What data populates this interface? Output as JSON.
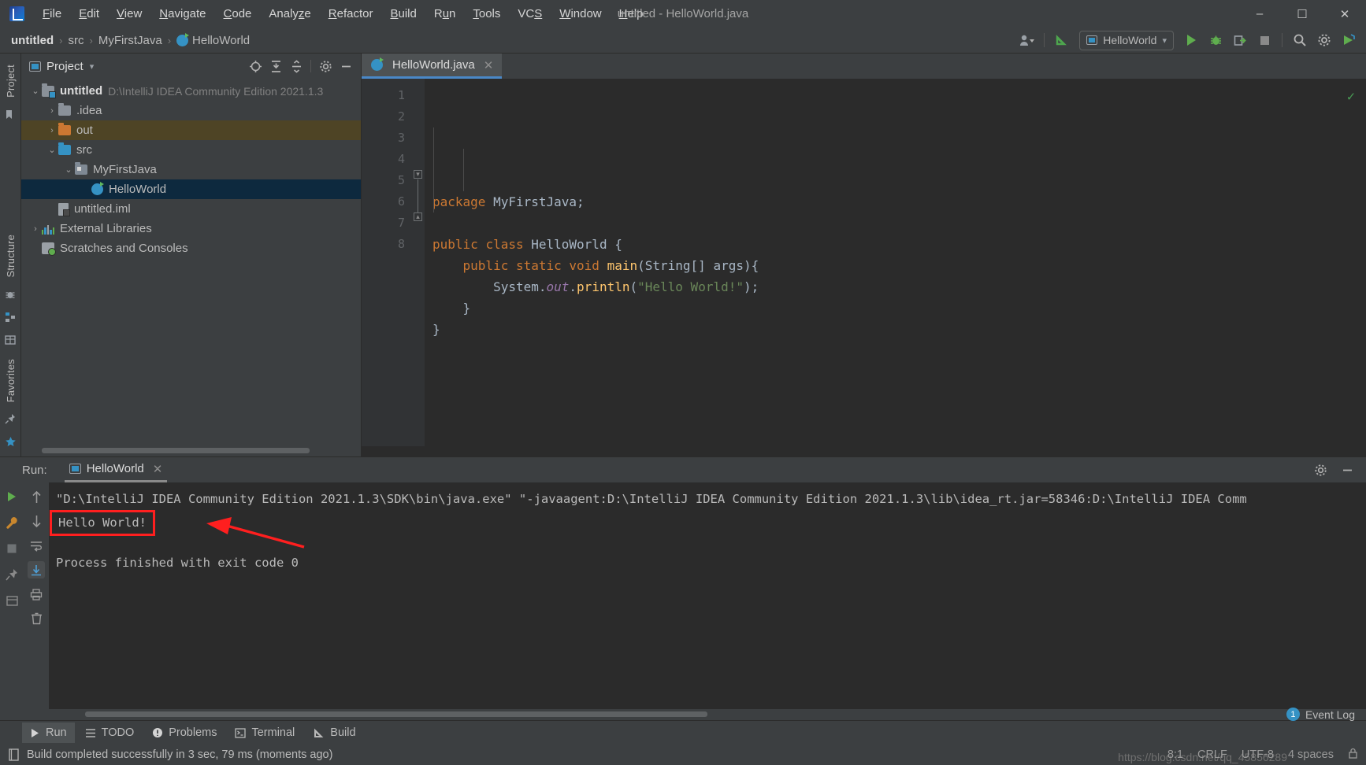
{
  "window": {
    "title": "untitled - HelloWorld.java",
    "minimize": "–",
    "maximize": "☐",
    "close": "✕"
  },
  "menubar": {
    "logo_name": "intellij-idea-logo",
    "items": [
      {
        "label": "File",
        "mnemonic": "F"
      },
      {
        "label": "Edit",
        "mnemonic": "E"
      },
      {
        "label": "View",
        "mnemonic": "V"
      },
      {
        "label": "Navigate",
        "mnemonic": "N"
      },
      {
        "label": "Code",
        "mnemonic": "C"
      },
      {
        "label": "Analyze",
        "mnemonic": "z"
      },
      {
        "label": "Refactor",
        "mnemonic": "R"
      },
      {
        "label": "Build",
        "mnemonic": "B"
      },
      {
        "label": "Run",
        "mnemonic": "u"
      },
      {
        "label": "Tools",
        "mnemonic": "T"
      },
      {
        "label": "VCS",
        "mnemonic": "S"
      },
      {
        "label": "Window",
        "mnemonic": "W"
      },
      {
        "label": "Help",
        "mnemonic": "H"
      }
    ]
  },
  "navbar": {
    "crumbs": [
      "untitled",
      "src",
      "MyFirstJava",
      "HelloWorld"
    ],
    "separator": "›",
    "run_config": "HelloWorld",
    "icons": {
      "account": "account-icon",
      "update": "update-project-icon",
      "run": "run-icon",
      "debug": "debug-icon",
      "run_coverage": "run-with-coverage-icon",
      "stop": "stop-icon",
      "search": "search-everywhere-icon",
      "settings": "settings-icon",
      "plugin": "plugin-icon"
    }
  },
  "left_strip": {
    "project_tab": "Project",
    "structure_tab": "Structure",
    "favorites_tab": "Favorites"
  },
  "project_panel": {
    "title": "Project",
    "toolbar_icons": [
      "locate-icon",
      "expand-all-icon",
      "collapse-all-icon",
      "gear-icon",
      "hide-icon"
    ],
    "tree": [
      {
        "label": "untitled",
        "path": "D:\\IntelliJ IDEA Community Edition 2021.1.3",
        "indent": 0,
        "arrow": "⌄",
        "icon": "module",
        "bold": true,
        "state": "normal"
      },
      {
        "label": ".idea",
        "path": "",
        "indent": 1,
        "arrow": "›",
        "icon": "folder-gray",
        "bold": false,
        "state": "normal"
      },
      {
        "label": "out",
        "path": "",
        "indent": 1,
        "arrow": "›",
        "icon": "folder-orange",
        "bold": false,
        "state": "amber"
      },
      {
        "label": "src",
        "path": "",
        "indent": 1,
        "arrow": "⌄",
        "icon": "folder-blue",
        "bold": false,
        "state": "normal"
      },
      {
        "label": "MyFirstJava",
        "path": "",
        "indent": 2,
        "arrow": "⌄",
        "icon": "folder-package",
        "bold": false,
        "state": "normal"
      },
      {
        "label": "HelloWorld",
        "path": "",
        "indent": 3,
        "arrow": "",
        "icon": "java-class",
        "bold": false,
        "state": "selected"
      },
      {
        "label": "untitled.iml",
        "path": "",
        "indent": 1,
        "arrow": "",
        "icon": "iml-file",
        "bold": false,
        "state": "normal"
      },
      {
        "label": "External Libraries",
        "path": "",
        "indent": 0,
        "arrow": "›",
        "icon": "libraries",
        "bold": false,
        "state": "normal"
      },
      {
        "label": "Scratches and Consoles",
        "path": "",
        "indent": 0,
        "arrow": "",
        "icon": "scratches",
        "bold": false,
        "state": "normal"
      }
    ]
  },
  "editor": {
    "tab_label": "HelloWorld.java",
    "tab_close": "✕",
    "inspection_ok": "✓",
    "line_numbers": [
      "1",
      "2",
      "3",
      "4",
      "5",
      "6",
      "7",
      "8"
    ],
    "code_lines": [
      {
        "n": 1,
        "text": "package MyFirstJava;"
      },
      {
        "n": 2,
        "text": ""
      },
      {
        "n": 3,
        "text": "public class HelloWorld {"
      },
      {
        "n": 4,
        "text": "    public static void main(String[] args){"
      },
      {
        "n": 5,
        "text": "        System.out.println(\"Hello World!\");"
      },
      {
        "n": 6,
        "text": "    }"
      },
      {
        "n": 7,
        "text": "}"
      },
      {
        "n": 8,
        "text": ""
      }
    ],
    "gutter_run_lines": [
      3,
      4
    ],
    "colors": {
      "keyword": "#cc7832",
      "string": "#6a8759",
      "field": "#9876aa",
      "method": "#ffc66d",
      "default": "#a9b7c6",
      "background": "#2b2b2b"
    }
  },
  "run_panel": {
    "label": "Run:",
    "tab": "HelloWorld",
    "tab_close": "✕",
    "console_lines": [
      "\"D:\\IntelliJ IDEA Community Edition 2021.1.3\\SDK\\bin\\java.exe\" \"-javaagent:D:\\IntelliJ IDEA Community Edition 2021.1.3\\lib\\idea_rt.jar=58346:D:\\IntelliJ IDEA Comm",
      "Hello World!",
      "",
      "Process finished with exit code 0"
    ],
    "highlighted_line": "Hello World!",
    "annotation_color": "#ff1f1f",
    "tool_icons": [
      "rerun-icon",
      "wrench-icon",
      "stop-icon",
      "pin-icon",
      "up-icon",
      "down-icon",
      "soft-wrap-icon",
      "scroll-to-end-icon",
      "print-icon",
      "trash-icon"
    ],
    "header_icons": [
      "settings-icon",
      "hide-icon"
    ]
  },
  "bottom_toolbar": {
    "items": [
      {
        "label": "Run",
        "icon": "run-icon",
        "active": true
      },
      {
        "label": "TODO",
        "icon": "todo-icon",
        "active": false
      },
      {
        "label": "Problems",
        "icon": "problems-icon",
        "active": false
      },
      {
        "label": "Terminal",
        "icon": "terminal-icon",
        "active": false
      },
      {
        "label": "Build",
        "icon": "build-icon",
        "active": false
      }
    ],
    "event_log": {
      "label": "Event Log",
      "count": "1"
    }
  },
  "statusbar": {
    "message": "Build completed successfully in 3 sec, 79 ms (moments ago)",
    "line_col": "8:1",
    "line_sep": "CRLF",
    "encoding": "UTF-8",
    "indent": "4 spaces",
    "watermark": "https://blog.csdn.net/qq_45856289"
  }
}
